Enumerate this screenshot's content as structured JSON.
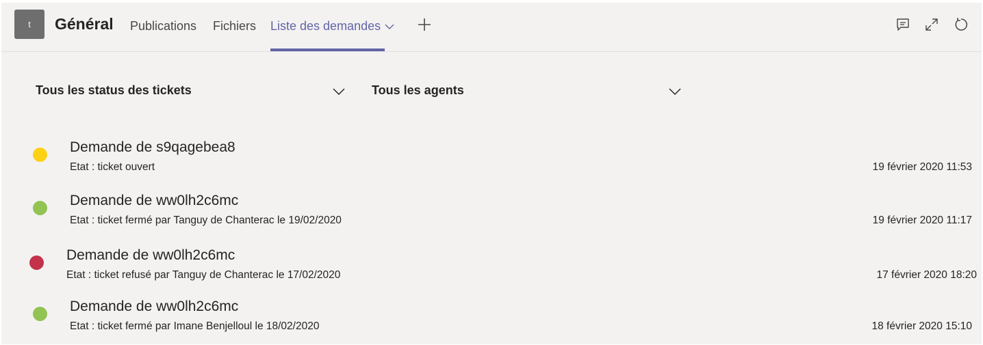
{
  "header": {
    "avatar_letter": "t",
    "channel_title": "Général",
    "tabs": [
      {
        "label": "Publications"
      },
      {
        "label": "Fichiers"
      },
      {
        "label": "Liste des demandes"
      }
    ],
    "active_tab_index": 2,
    "icons": [
      "add-tab-icon",
      "conversation-icon",
      "expand-icon",
      "refresh-icon"
    ]
  },
  "colors": {
    "accent": "#6264a7",
    "status_open": "#fcd116",
    "status_closed": "#92c353",
    "status_refused": "#c4314b"
  },
  "filters": {
    "status_label": "Tous les status des tickets",
    "agents_label": "Tous les agents"
  },
  "tickets": [
    {
      "title": "Demande de s9qagebea8",
      "status": "Etat : ticket ouvert",
      "date": "19 février 2020 11:53",
      "state": "open",
      "color": "#fcd116"
    },
    {
      "title": "Demande de ww0lh2c6mc",
      "status": "Etat : ticket fermé par Tanguy de Chanterac le 19/02/2020",
      "date": "19 février 2020 11:17",
      "state": "closed",
      "color": "#92c353"
    },
    {
      "title": "Demande de ww0lh2c6mc",
      "status": "Etat : ticket refusé par Tanguy de Chanterac le 17/02/2020",
      "date": "17 février 2020 18:20",
      "state": "refused",
      "color": "#c4314b"
    },
    {
      "title": "Demande de ww0lh2c6mc",
      "status": "Etat : ticket fermé par Imane Benjelloul le 18/02/2020",
      "date": "18 février 2020 15:10",
      "state": "closed",
      "color": "#92c353"
    }
  ]
}
